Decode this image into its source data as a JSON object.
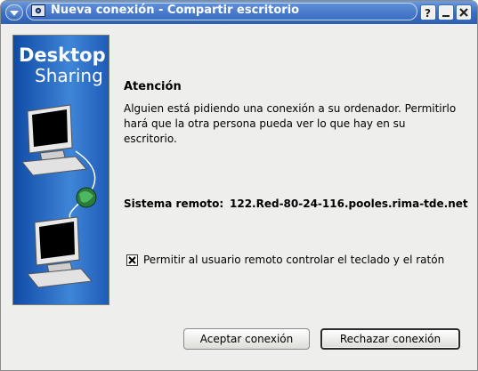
{
  "window": {
    "title": "Nueva conexión - Compartir escritorio",
    "controls": {
      "help": "?",
      "minimize": "minimize-icon",
      "close": "close-icon"
    }
  },
  "banner": {
    "line1": "Desktop",
    "line2": "Sharing"
  },
  "dialog": {
    "heading": "Atención",
    "message": "Alguien está pidiendo una conexión a su ordenador. Permitirlo hará que la otra persona pueda ver lo que hay en su escritorio.",
    "remote_label": "Sistema remoto:",
    "remote_value": "122.Red-80-24-116.pooles.rima-tde.net",
    "allow_control_label": "Permitir al usuario remoto controlar el teclado y el ratón",
    "allow_control_checked": true
  },
  "buttons": {
    "accept": "Aceptar conexión",
    "reject": "Rechazar conexión"
  }
}
